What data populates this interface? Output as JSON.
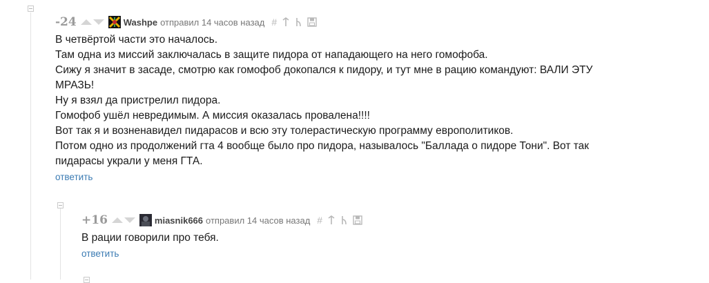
{
  "comments": [
    {
      "rating": "-24",
      "author": "Washpe",
      "meta": "отправил 14 часов назад",
      "lines": [
        "В четвёртой части это началось.",
        "Там одна из миссий заключалась в защите пидора от нападающего на него гомофоба.",
        "Сижу я значит в засаде, смотрю как гомофоб докопался к пидору, и тут мне в рацию командуют: ВАЛИ ЭТУ",
        "МРАЗЬ!",
        "Ну я взял да пристрелил пидора.",
        "Гомофоб ушёл невредимым. А миссия оказалась провалена!!!!",
        "Вот так я и возненавидел пидарасов и всю эту толерастическую программу европолитиков.",
        "Потом одно из продолжений гта 4 вообще было про пидора, называлось \"Баллада о пидоре Тони\". Вот так",
        "пидарасы украли у меня ГТА."
      ],
      "reply_label": "ответить",
      "action_icons": [
        "hash-icon",
        "arrow-up-parent-icon",
        "branch-icon",
        "save-icon"
      ]
    },
    {
      "rating": "+16",
      "author": "miasnik666",
      "meta": "отправил 14 часов назад",
      "lines": [
        "В рации говорили про тебя."
      ],
      "reply_label": "ответить",
      "action_icons": [
        "hash-icon",
        "arrow-up-parent-icon",
        "branch-icon",
        "save-icon"
      ]
    }
  ],
  "colors": {
    "link": "#3b7bb3",
    "rating": "#9a9a9a",
    "meta": "#777777",
    "guide": "#e3e3e3"
  }
}
